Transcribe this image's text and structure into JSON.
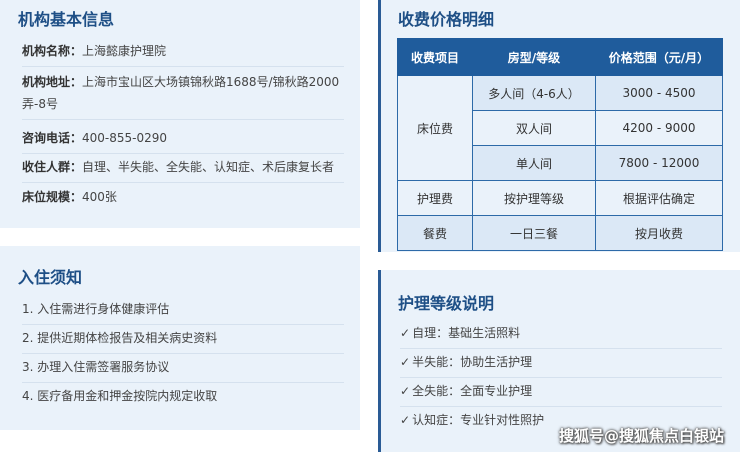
{
  "basic": {
    "title": "机构基本信息",
    "rows": [
      {
        "label": "机构名称：",
        "value": "上海懿康护理院"
      },
      {
        "label": "机构地址：",
        "value": "上海市宝山区大场镇锦秋路1688号/锦秋路2000弄-8号"
      },
      {
        "label": "咨询电话：",
        "value": "400-855-0290"
      },
      {
        "label": "收住人群：",
        "value": "自理、半失能、全失能、认知症、术后康复长者"
      },
      {
        "label": "床位规模：",
        "value": "400张"
      }
    ]
  },
  "notice": {
    "title": "入住须知",
    "items": [
      "1. 入住需进行身体健康评估",
      "2. 提供近期体检报告及相关病史资料",
      "3. 办理入住需签署服务协议",
      "4. 医疗备用金和押金按院内规定收取"
    ]
  },
  "price": {
    "title": "收费价格明细",
    "headers": [
      "收费项目",
      "房型/等级",
      "价格范围（元/月）"
    ],
    "bed_label": "床位费",
    "bed_rows": [
      {
        "type": "多人间（4-6人）",
        "price": "3000 - 4500"
      },
      {
        "type": "双人间",
        "price": "4200 - 9000"
      },
      {
        "type": "单人间",
        "price": "7800 - 12000"
      }
    ],
    "other_rows": [
      {
        "item": "护理费",
        "type": "按护理等级",
        "price": "根据评估确定"
      },
      {
        "item": "餐费",
        "type": "一日三餐",
        "price": "按月收费"
      }
    ]
  },
  "level": {
    "title": "护理等级说明",
    "check": "✓",
    "items": [
      "自理：基础生活照料",
      "半失能：协助生活护理",
      "全失能：全面专业护理",
      "认知症：专业针对性照护"
    ]
  },
  "watermark": "搜狐号@搜狐焦点白银站"
}
